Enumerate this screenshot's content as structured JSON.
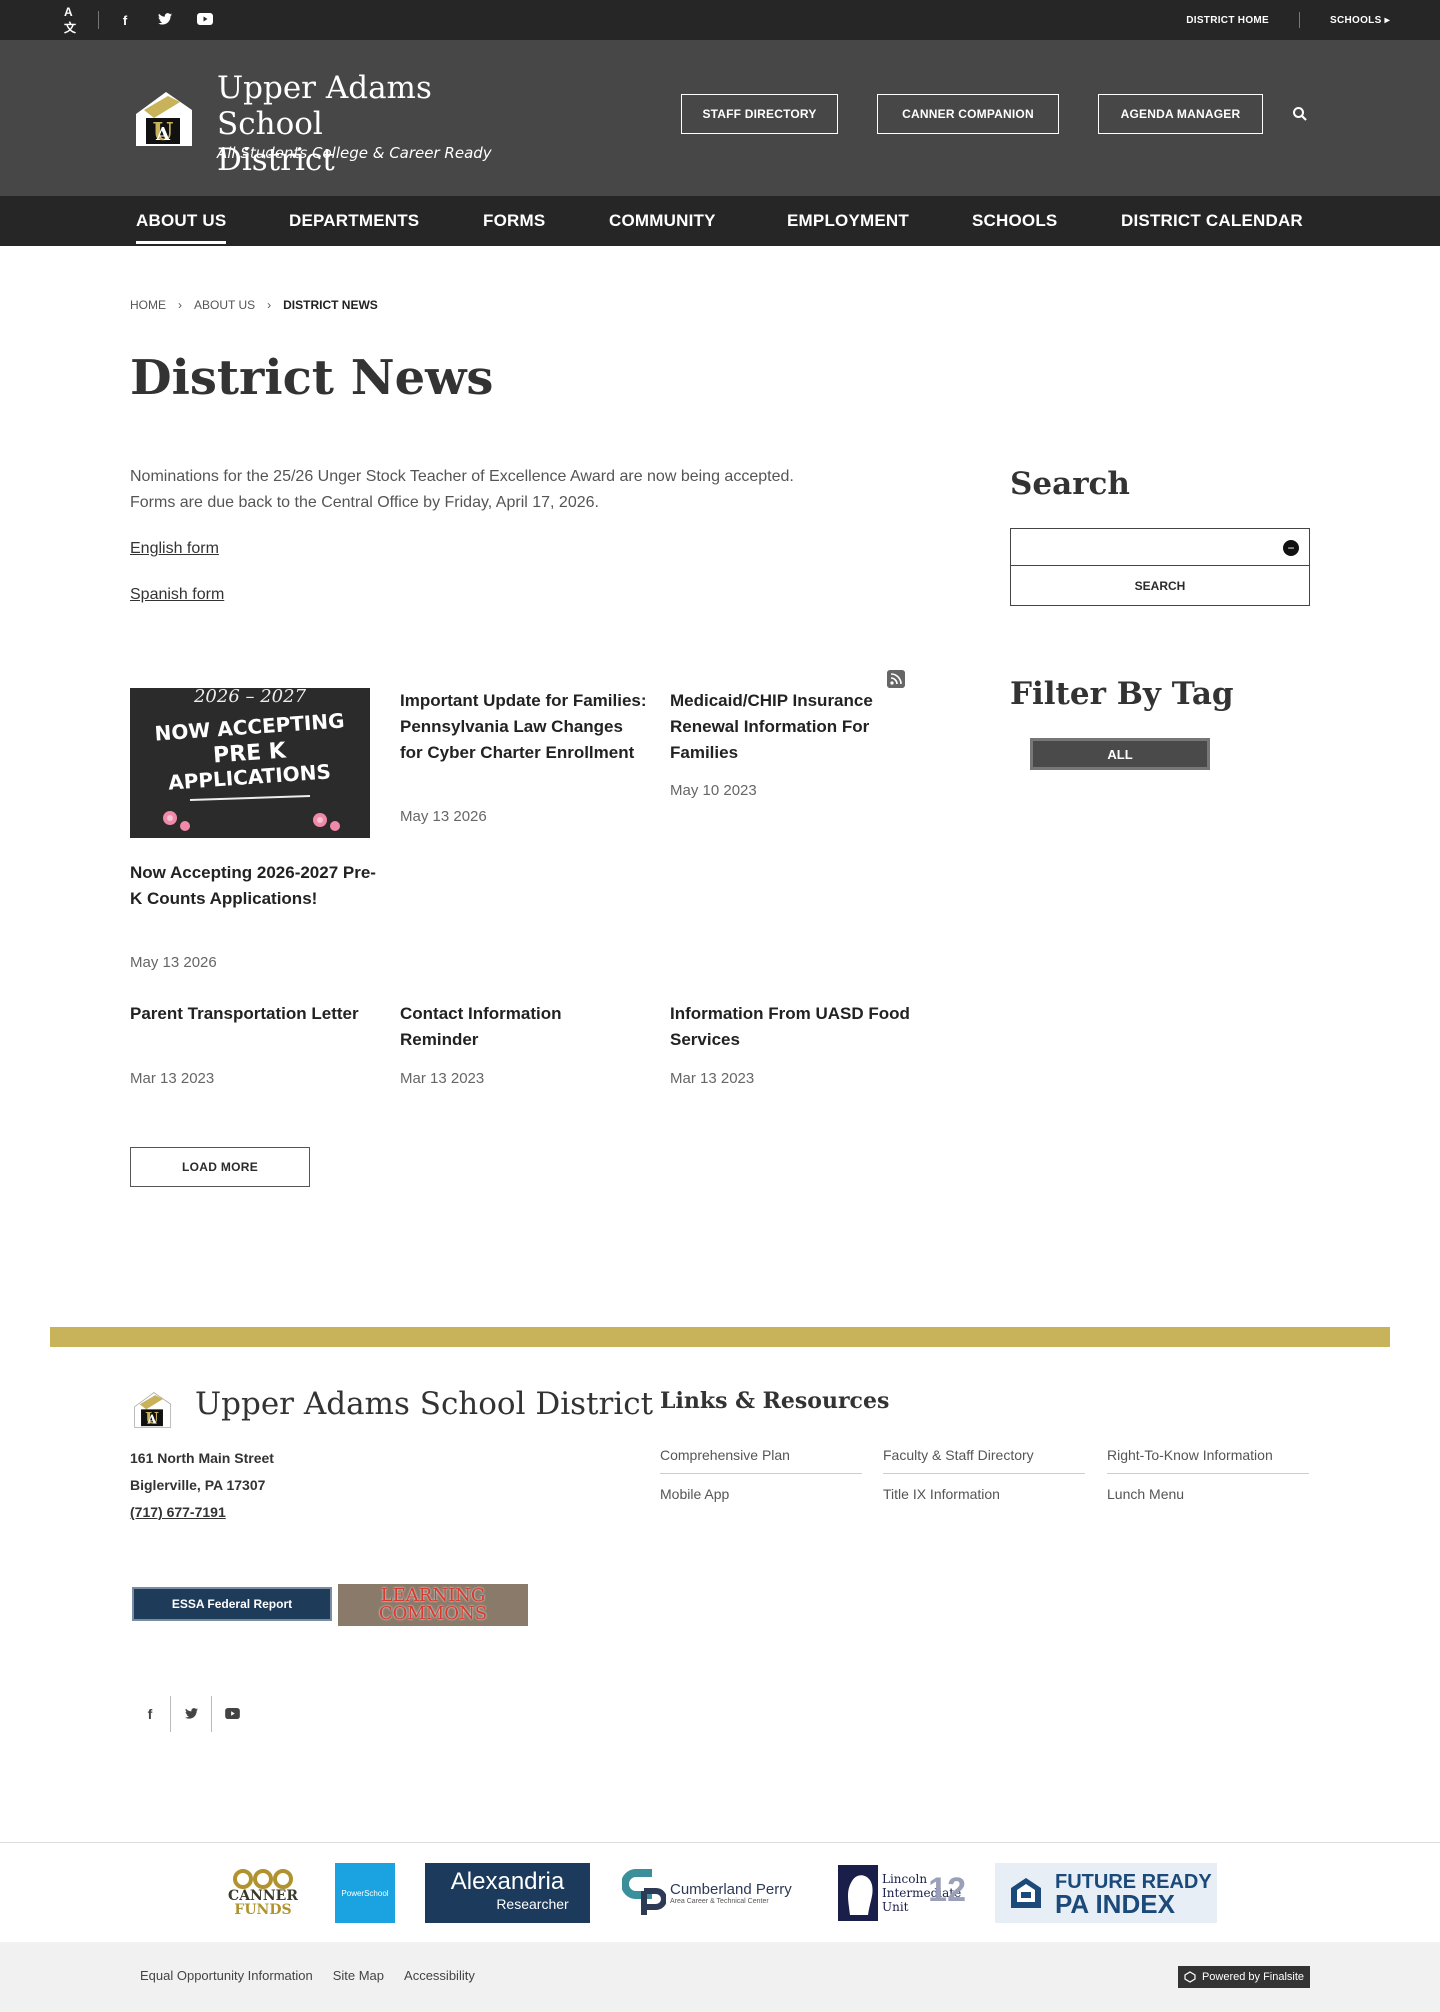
{
  "utility": {
    "translate_label": "A文",
    "social": [
      "f",
      "t",
      "▶"
    ],
    "district_home": "DISTRICT HOME",
    "schools": "SCHOOLS"
  },
  "header": {
    "site_name_line1": "Upper Adams School",
    "site_name_line2": "District",
    "tagline": "All Students College & Career Ready",
    "buttons": [
      "STAFF DIRECTORY",
      "CANNER COMPANION",
      "AGENDA MANAGER"
    ]
  },
  "nav": [
    "ABOUT US",
    "DEPARTMENTS",
    "FORMS",
    "COMMUNITY",
    "EMPLOYMENT",
    "SCHOOLS",
    "DISTRICT CALENDAR"
  ],
  "breadcrumb": {
    "home": "HOME",
    "about": "ABOUT US",
    "current": "DISTRICT NEWS",
    "sep": "›"
  },
  "page_title": "District News",
  "intro": "Nominations for the 25/26 Unger Stock Teacher of Excellence Award are now being accepted. Forms are due back to the Central Office by Friday, April 17, 2026.",
  "intro_links": [
    "English form",
    "Spanish form"
  ],
  "news_image": {
    "line1": "2026 – 2027",
    "line2": "NOW ACCEPTING",
    "line3": "PRE K",
    "line4": "APPLICATIONS"
  },
  "news": [
    {
      "title": "Now Accepting 2026-2027 Pre-K Counts Applications!",
      "date": "May 13 2026"
    },
    {
      "title": "Important Update for Families: Pennsylvania Law Changes for Cyber Charter Enrollment",
      "date": "May 13 2026"
    },
    {
      "title": "Medicaid/CHIP Insurance Renewal Information For Families",
      "date": "May 10 2023"
    },
    {
      "title": "Parent Transportation Letter",
      "date": "Mar 13 2023"
    },
    {
      "title": "Contact Information Reminder",
      "date": "Mar 13 2023"
    },
    {
      "title": "Information From UASD Food Services",
      "date": "Mar 13 2023"
    }
  ],
  "load_more": "LOAD MORE",
  "sidebar": {
    "search_heading": "Search",
    "search_button": "SEARCH",
    "clear_icon": "−",
    "filter_heading": "Filter By Tag",
    "tag_all": "ALL"
  },
  "footer": {
    "name": "Upper Adams School District",
    "address1": "161 North Main Street",
    "address2": "Biglerville, PA  17307",
    "phone": "(717) 677-7191",
    "links_heading": "Links & Resources",
    "links": [
      "Comprehensive Plan",
      "Faculty & Staff Directory",
      "Right-To-Know Information",
      "Mobile App",
      "Title IX Information",
      "Lunch Menu"
    ],
    "essa": "ESSA Federal Report",
    "commons_1": "LEARNING",
    "commons_2": "COMMONS",
    "social": [
      "f",
      "t",
      "▶"
    ]
  },
  "partners": {
    "canner_1": "CANNER",
    "canner_2": "FUNDS",
    "powerschool": "PowerSchool",
    "alexandria_1": "Alexandria",
    "alexandria_2": "Researcher",
    "cumberland_1": "Cumberland Perry",
    "cumberland_2": "Area Career & Technical Center",
    "lincoln_1": "Lincoln",
    "lincoln_2": "Intermediate",
    "lincoln_3": "Unit",
    "lincoln_num": "12",
    "future_1": "FUTURE READY",
    "future_2": "PA INDEX"
  },
  "bottom": {
    "links": [
      "Equal Opportunity Information",
      "Site Map",
      "Accessibility"
    ],
    "powered": "Powered by Finalsite"
  },
  "colors": {
    "gold": "#c9b35a",
    "header": "#474747",
    "nav": "#262626"
  }
}
